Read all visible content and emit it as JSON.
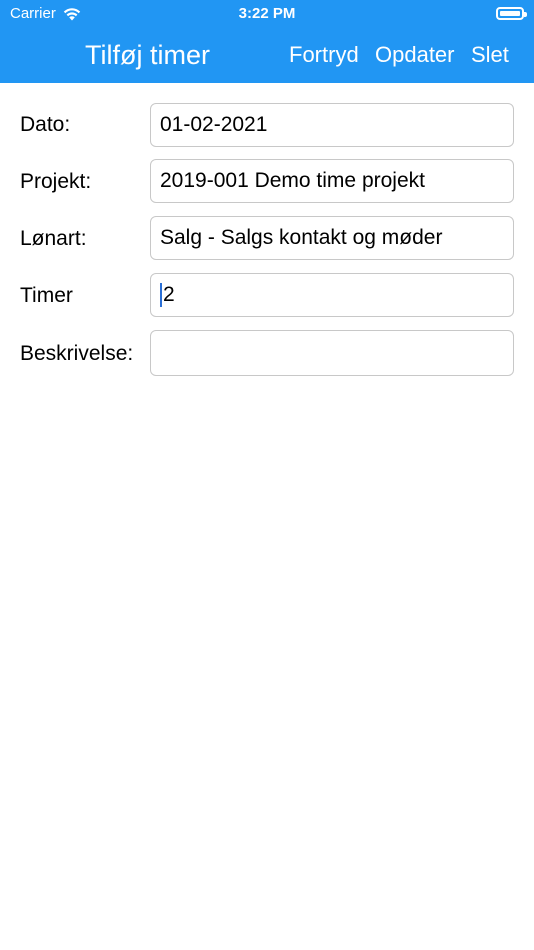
{
  "status_bar": {
    "carrier": "Carrier",
    "time": "3:22 PM",
    "wifi_icon": "wifi-icon",
    "battery_icon": "battery-icon"
  },
  "nav": {
    "title": "Tilføj timer",
    "buttons": {
      "cancel": "Fortryd",
      "update": "Opdater",
      "delete": "Slet"
    },
    "background_color": "#2196f3"
  },
  "form": {
    "date": {
      "label": "Dato:",
      "value": "01-02-2021"
    },
    "project": {
      "label": "Projekt:",
      "value": "2019-001 Demo time projekt"
    },
    "wage_type": {
      "label": "Lønart:",
      "value": "Salg - Salgs kontakt og møder"
    },
    "hours": {
      "label": "Timer",
      "value": "2"
    },
    "description": {
      "label": "Beskrivelse:",
      "value": ""
    }
  }
}
